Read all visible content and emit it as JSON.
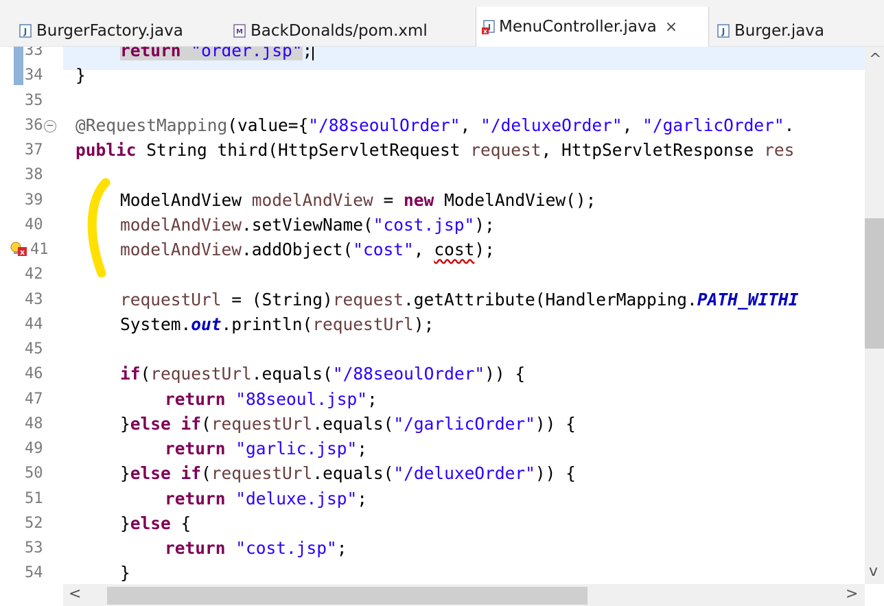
{
  "tabs": [
    {
      "label": "BurgerFactory.java",
      "icon": "java-file-icon"
    },
    {
      "label": "BackDonalds/pom.xml",
      "icon": "maven-pom-icon"
    },
    {
      "label": "MenuController.java",
      "icon": "java-file-error-icon",
      "active": true,
      "close": "×"
    },
    {
      "label": "Burger.java",
      "icon": "java-file-icon"
    }
  ],
  "line_numbers": [
    "33",
    "34",
    "35",
    "36",
    "37",
    "38",
    "39",
    "40",
    "41",
    "42",
    "43",
    "44",
    "45",
    "46",
    "47",
    "48",
    "49",
    "50",
    "51",
    "52",
    "53",
    "54"
  ],
  "code": {
    "l33": {
      "kw": "return",
      "s": "\"order.jsp\"",
      "end": ";"
    },
    "l34": "}",
    "l36": {
      "ann": "@RequestMapping",
      "a": "(value={",
      "s1": "\"/88seoulOrder\"",
      "c1": ", ",
      "s2": "\"/deluxeOrder\"",
      "c2": ", ",
      "s3": "\"/garlicOrder\"",
      "end": "."
    },
    "l37": {
      "kw": "public",
      "a": " String third(HttpServletRequest ",
      "v1": "request",
      "b": ", HttpServletResponse ",
      "v2": "res"
    },
    "l39": {
      "a": "ModelAndView ",
      "v": "modelAndView",
      "b": " = ",
      "kw": "new",
      "c": " ModelAndView();"
    },
    "l40": {
      "v": "modelAndView",
      "a": ".setViewName(",
      "s": "\"cost.jsp\"",
      "b": ");"
    },
    "l41": {
      "v": "modelAndView",
      "a": ".addObject(",
      "s": "\"cost\"",
      "b": ", ",
      "err": "cost",
      "c": ");"
    },
    "l43": {
      "v1": "requestUrl",
      "a": " = (String)",
      "v2": "request",
      "b": ".getAttribute(HandlerMapping.",
      "f": "PATH_WITHI"
    },
    "l44": {
      "a": "System.",
      "f": "out",
      "b": ".println(",
      "v": "requestUrl",
      "c": ");"
    },
    "l46": {
      "kw": "if",
      "a": "(",
      "v": "requestUrl",
      "b": ".equals(",
      "s": "\"/88seoulOrder\"",
      "c": ")) {"
    },
    "l47": {
      "kw": "return",
      "s": "\"88seoul.jsp\"",
      "end": ";"
    },
    "l48": {
      "a": "}",
      "kw": "else if",
      "b": "(",
      "v": "requestUrl",
      "c": ".equals(",
      "s": "\"/garlicOrder\"",
      "d": ")) {"
    },
    "l49": {
      "kw": "return",
      "s": "\"garlic.jsp\"",
      "end": ";"
    },
    "l50": {
      "a": "}",
      "kw": "else if",
      "b": "(",
      "v": "requestUrl",
      "c": ".equals(",
      "s": "\"/deluxeOrder\"",
      "d": ")) {"
    },
    "l51": {
      "kw": "return",
      "s": "\"deluxe.jsp\"",
      "end": ";"
    },
    "l52": {
      "a": "}",
      "kw": "else",
      "b": " {"
    },
    "l53": {
      "kw": "return",
      "s": "\"cost.jsp\"",
      "end": ";"
    },
    "l54": "}"
  },
  "scroll": {
    "up": "^",
    "down": "v",
    "left": "<",
    "right": ">"
  },
  "colors": {
    "keyword": "#7f0055",
    "string": "#2a00ff",
    "variable": "#6a3e3e",
    "field": "#0000c0",
    "highlighter": "#ffe000"
  }
}
